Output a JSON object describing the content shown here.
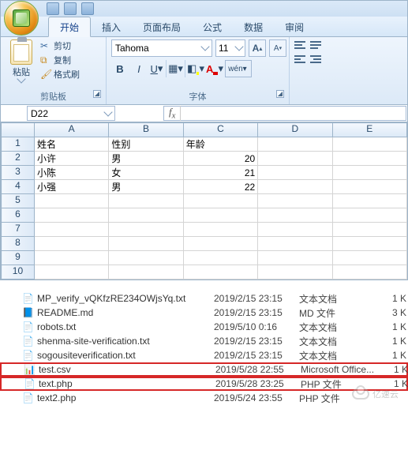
{
  "ribbon": {
    "tabs": [
      "开始",
      "插入",
      "页面布局",
      "公式",
      "数据",
      "审阅"
    ],
    "clipboard": {
      "paste": "粘贴",
      "cut": "剪切",
      "copy": "复制",
      "painter": "格式刷",
      "label": "剪贴板"
    },
    "font": {
      "name": "Tahoma",
      "size": "11",
      "grow": "A",
      "shrink": "A",
      "bold": "B",
      "italic": "I",
      "underline": "U",
      "wen": "wén",
      "label": "字体"
    }
  },
  "namebox": "D22",
  "sheet": {
    "cols": [
      "A",
      "B",
      "C",
      "D",
      "E"
    ],
    "rowcount": 10,
    "data": [
      [
        "姓名",
        "性别",
        "年龄",
        "",
        ""
      ],
      [
        "小许",
        "男",
        "20",
        "",
        ""
      ],
      [
        "小陈",
        "女",
        "21",
        "",
        ""
      ],
      [
        "小强",
        "男",
        "22",
        "",
        ""
      ],
      [
        "",
        "",
        "",
        "",
        ""
      ],
      [
        "",
        "",
        "",
        "",
        ""
      ],
      [
        "",
        "",
        "",
        "",
        ""
      ],
      [
        "",
        "",
        "",
        "",
        ""
      ],
      [
        "",
        "",
        "",
        "",
        ""
      ],
      [
        "",
        "",
        "",
        "",
        ""
      ]
    ]
  },
  "files": [
    {
      "icon": "txt",
      "name": "MP_verify_vQKfzRE234OWjsYq.txt",
      "date": "2019/2/15 23:15",
      "type": "文本文档",
      "size": "1 K",
      "hl": false
    },
    {
      "icon": "md",
      "name": "README.md",
      "date": "2019/2/15 23:15",
      "type": "MD 文件",
      "size": "3 K",
      "hl": false
    },
    {
      "icon": "txt",
      "name": "robots.txt",
      "date": "2019/5/10 0:16",
      "type": "文本文档",
      "size": "1 K",
      "hl": false
    },
    {
      "icon": "txt",
      "name": "shenma-site-verification.txt",
      "date": "2019/2/15 23:15",
      "type": "文本文档",
      "size": "1 K",
      "hl": false
    },
    {
      "icon": "txt",
      "name": "sogousiteverification.txt",
      "date": "2019/2/15 23:15",
      "type": "文本文档",
      "size": "1 K",
      "hl": false
    },
    {
      "icon": "csv",
      "name": "test.csv",
      "date": "2019/5/28 22:55",
      "type": "Microsoft Office...",
      "size": "1 K",
      "hl": true
    },
    {
      "icon": "php",
      "name": "text.php",
      "date": "2019/5/28 23:25",
      "type": "PHP 文件",
      "size": "1 K",
      "hl": true
    },
    {
      "icon": "php",
      "name": "text2.php",
      "date": "2019/5/24 23:55",
      "type": "PHP 文件",
      "size": "",
      "hl": false
    }
  ],
  "watermark": "亿速云"
}
